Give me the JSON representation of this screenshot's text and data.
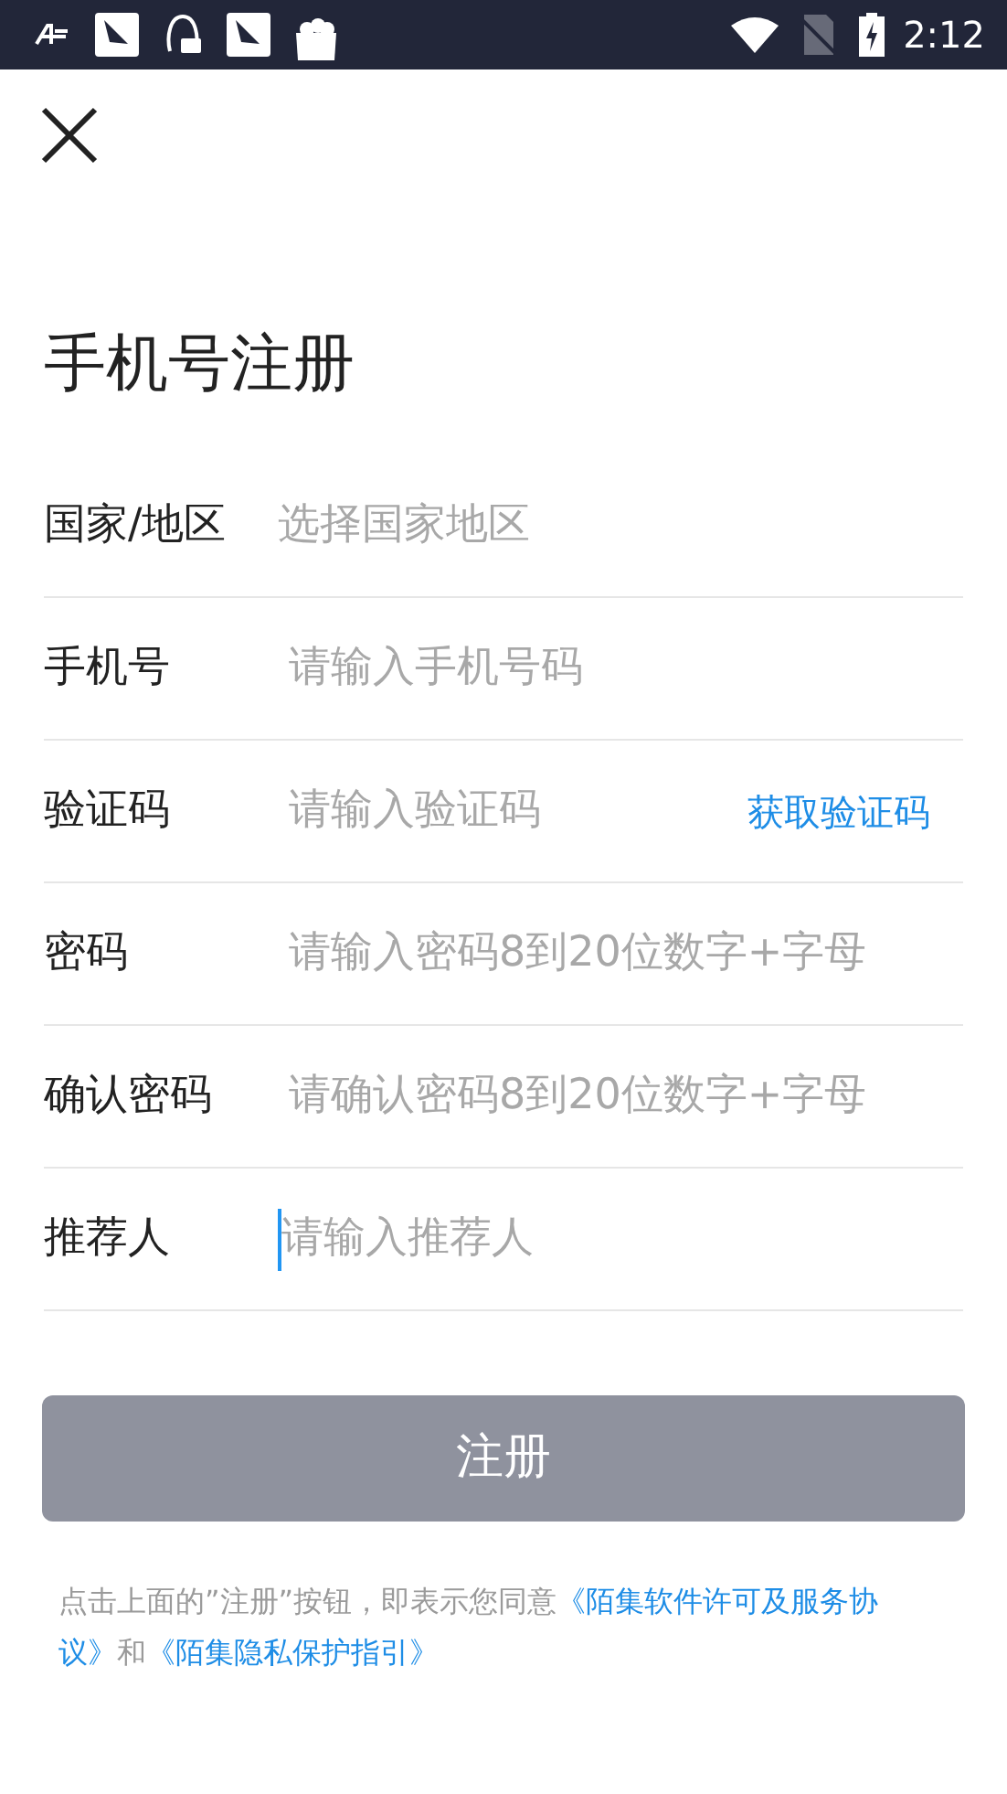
{
  "status_bar": {
    "time": "2:12"
  },
  "title": "手机号注册",
  "fields": [
    {
      "kind": "select",
      "label": "国家/地区",
      "placeholder": "选择国家地区",
      "focused": false
    },
    {
      "kind": "input",
      "label": "手机号",
      "placeholder": "请输入手机号码",
      "focused": false
    },
    {
      "kind": "code",
      "label": "验证码",
      "placeholder": "请输入验证码",
      "action": "获取验证码",
      "focused": false
    },
    {
      "kind": "input",
      "label": "密码",
      "placeholder": "请输入密码8到20位数字+字母",
      "focused": false
    },
    {
      "kind": "input",
      "label": "确认密码",
      "placeholder": "请确认密码8到20位数字+字母",
      "focused": false
    },
    {
      "kind": "input",
      "label": "推荐人",
      "placeholder": "请输入推荐人",
      "focused": true
    }
  ],
  "submit": {
    "label": "注册",
    "disabled": true
  },
  "terms": "点击上面的”注册”按钮，即表示您同意",
  "terms_links": [
    "《陌集软件许可及服务协议》",
    "《陌集隐私保护指引》"
  ],
  "terms_joiner": "和"
}
